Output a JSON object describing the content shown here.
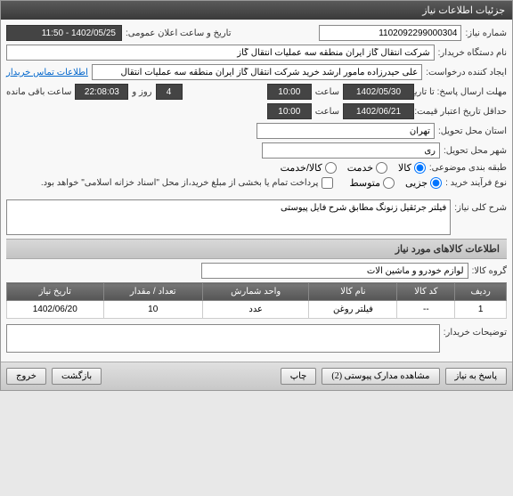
{
  "titlebar": "جزئیات اطلاعات نیاز",
  "fields": {
    "need_no_label": "شماره نیاز:",
    "need_no": "1102092299000304",
    "announce_label": "تاریخ و ساعت اعلان عمومی:",
    "announce_value": "1402/05/25 - 11:50",
    "buyer_label": "نام دستگاه خریدار:",
    "buyer_value": "شرکت انتقال گاز ایران منطقه سه عملیات انتقال گاز",
    "creator_label": "ایجاد کننده درخواست:",
    "creator_value": "علی حیدرزاده مامور ارشد خرید شرکت انتقال گاز ایران منطقه سه عملیات انتقال",
    "contact_link": "اطلاعات تماس خریدار",
    "deadline_label": "مهلت ارسال پاسخ: تا تاریخ:",
    "deadline_date": "1402/05/30",
    "time_label": "ساعت",
    "deadline_time": "10:00",
    "day_label": "روز و",
    "days_remain": "4",
    "time_remain": "22:08:03",
    "remain_label": "ساعت باقی مانده",
    "validity_label": "حداقل تاریخ اعتبار قیمت: تا تاریخ:",
    "validity_date": "1402/06/21",
    "validity_time": "10:00",
    "delivery_addr_label": "استان محل تحویل:",
    "delivery_addr": "تهران",
    "delivery_city_label": "شهر محل تحویل:",
    "delivery_city": "ری",
    "category_label": "طبقه بندی موضوعی:",
    "cat_goods": "کالا",
    "cat_service": "خدمت",
    "cat_both": "کالا/خدمت",
    "process_label": "نوع فرآیند خرید :",
    "proc_partial": "جزیی",
    "proc_medium": "متوسط",
    "payment_note": "پرداخت تمام یا بخشی از مبلغ خرید،از محل \"اسناد خزانه اسلامی\" خواهد بود.",
    "desc_label": "شرح کلی نیاز:",
    "desc_value": "فیلتر جرثقیل زنونگ مطابق شرح فایل پیوستی",
    "goods_header": "اطلاعات کالاهای مورد نیاز",
    "group_label": "گروه کالا:",
    "group_value": "لوازم خودرو و ماشین آلات",
    "buyer_notes_label": "توضیحات خریدار:"
  },
  "table": {
    "headers": {
      "row": "ردیف",
      "code": "کد کالا",
      "name": "نام کالا",
      "unit": "واحد شمارش",
      "qty": "تعداد / مقدار",
      "date": "تاریخ نیاز"
    },
    "rows": [
      {
        "row": "1",
        "code": "--",
        "name": "فیلتر روغن",
        "unit": "عدد",
        "qty": "10",
        "date": "1402/06/20"
      }
    ]
  },
  "footer": {
    "respond": "پاسخ به نیاز",
    "attachments": "مشاهده مدارک پیوستی (2)",
    "print": "چاپ",
    "back": "بازگشت",
    "exit": "خروج"
  }
}
